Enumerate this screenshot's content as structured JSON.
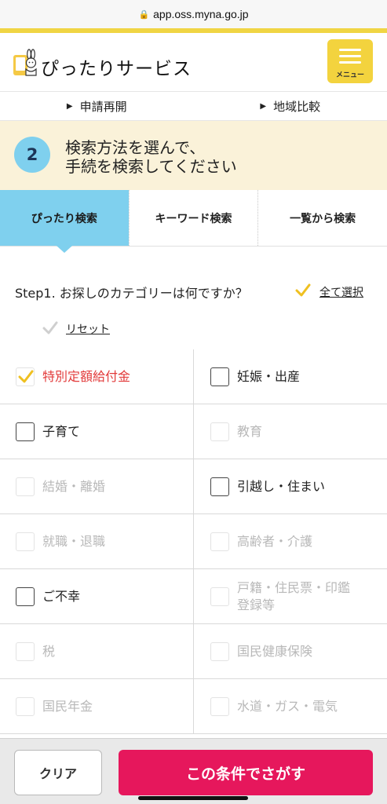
{
  "browser": {
    "url": "app.oss.myna.go.jp"
  },
  "header": {
    "brand": "ぴったりサービス",
    "menu_label": "メニュー"
  },
  "subnav": {
    "items": [
      {
        "label": "申請再開"
      },
      {
        "label": "地域比較"
      }
    ]
  },
  "step": {
    "number": "2",
    "line1": "検索方法を選んで、",
    "line2": "手続を検索してください"
  },
  "tabs": [
    {
      "label": "ぴったり検索",
      "active": true
    },
    {
      "label": "キーワード検索"
    },
    {
      "label": "一覧から検索"
    }
  ],
  "step1": {
    "question": "Step1. お探しのカテゴリーは何ですか？",
    "select_all": "全て選択",
    "reset": "リセット"
  },
  "categories": [
    {
      "left": {
        "label": "特別定額給付金",
        "state": "checked"
      },
      "right": {
        "label": "妊娠・出産",
        "state": "enabled"
      }
    },
    {
      "left": {
        "label": "子育て",
        "state": "enabled"
      },
      "right": {
        "label": "教育",
        "state": "disabled"
      }
    },
    {
      "left": {
        "label": "結婚・離婚",
        "state": "disabled"
      },
      "right": {
        "label": "引越し・住まい",
        "state": "enabled"
      }
    },
    {
      "left": {
        "label": "就職・退職",
        "state": "disabled"
      },
      "right": {
        "label": "高齢者・介護",
        "state": "disabled"
      }
    },
    {
      "left": {
        "label": "ご不幸",
        "state": "enabled"
      },
      "right": {
        "label": "戸籍・住民票・印鑑登録等",
        "label_line1": "戸籍・住民票・印鑑",
        "label_line2": "登録等",
        "state": "disabled"
      }
    },
    {
      "left": {
        "label": "税",
        "state": "disabled"
      },
      "right": {
        "label": "国民健康保険",
        "state": "disabled"
      }
    },
    {
      "left": {
        "label": "国民年金",
        "state": "disabled"
      },
      "right": {
        "label": "水道・ガス・電気",
        "state": "disabled"
      }
    }
  ],
  "actions": {
    "clear": "クリア",
    "search": "この条件でさがす"
  },
  "colors": {
    "accent_yellow": "#f3d33e",
    "tab_active": "#7fd0ee",
    "banner": "#faf2d9",
    "primary_button": "#e6175c",
    "checked_label": "#e23b3b"
  }
}
